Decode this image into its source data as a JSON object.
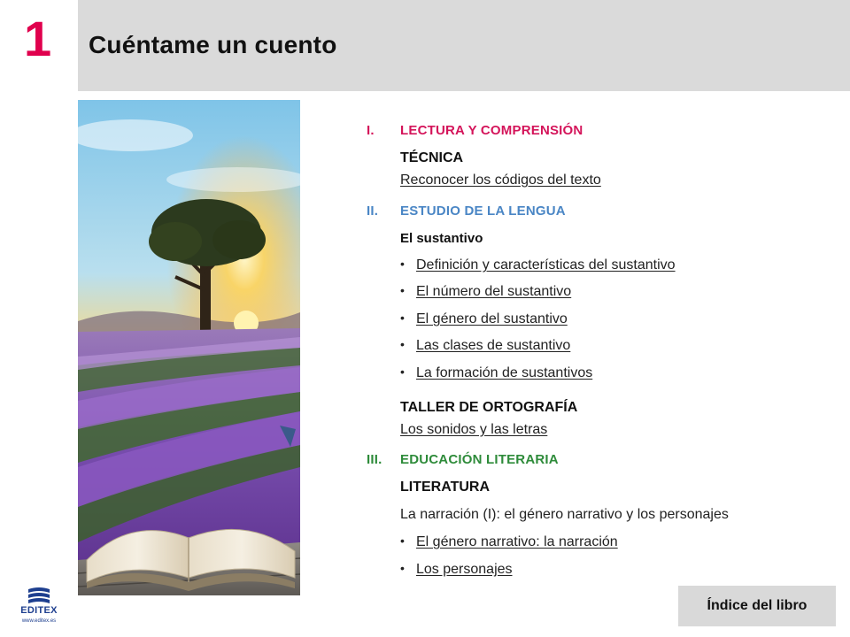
{
  "header": {
    "chapter_number": "1",
    "title": "Cuéntame un cuento"
  },
  "logo": {
    "word": "EDITEX",
    "url": "www.editex.es"
  },
  "colors": {
    "accent_red": "#e0004d",
    "section_1": "#d4145a",
    "section_2": "#4a86c5",
    "section_3": "#2e8b3a",
    "header_bg": "#dadada",
    "button_bg": "#d9d9d9",
    "logo_blue": "#1e3f8f"
  },
  "sections": {
    "s1": {
      "roman": "I.",
      "heading": "LECTURA Y COMPRENSIÓN",
      "sub": "TÉCNICA",
      "link": "Reconocer los códigos del texto"
    },
    "s2": {
      "roman": "II.",
      "heading": "ESTUDIO DE LA LENGUA",
      "sub": "El sustantivo",
      "items": [
        "Definición y características del sustantivo",
        "El número del sustantivo",
        "El género del sustantivo",
        "Las clases de sustantivo",
        "La formación de sustantivos"
      ],
      "sub2": "TALLER DE ORTOGRAFÍA",
      "link2": "Los sonidos y las letras"
    },
    "s3": {
      "roman": "III.",
      "heading": "EDUCACIÓN LITERARIA",
      "sub": "LITERATURA",
      "text": "La narración (I): el género narrativo y los personajes",
      "items": [
        "El género narrativo: la narración",
        "Los personajes"
      ]
    }
  },
  "footer": {
    "index_button": "Índice del libro"
  }
}
